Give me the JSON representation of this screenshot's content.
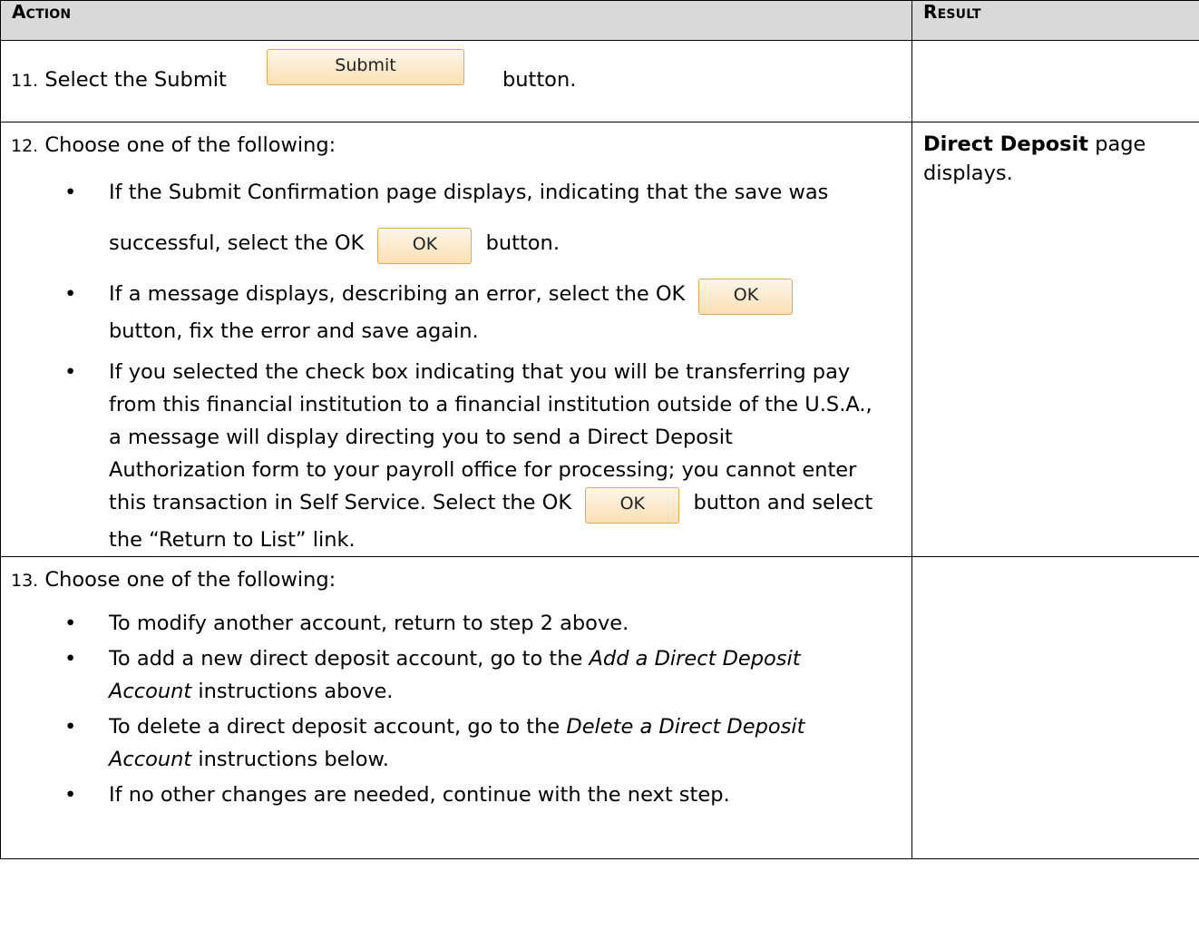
{
  "header": {
    "action": "Action",
    "result": "Result"
  },
  "step11": {
    "num": "11.",
    "text_before": "Select the Submit",
    "button": "Submit",
    "text_after": "button."
  },
  "step12": {
    "num": "12.",
    "intro": "Choose one of the following:",
    "bullet1_a": "If the Submit Confirmation page displays, indicating that the save was successful, select the OK",
    "bullet1_btn": "OK",
    "bullet1_b": "button.",
    "bullet2_a": "If a message displays, describing an error, select the OK",
    "bullet2_btn": "OK",
    "bullet2_b": "button, fix the error and save again.",
    "bullet3_a": "If you selected the check box indicating that you will be transferring pay from this financial institution to a financial institution outside of the U.S.A., a message will display directing you to send a Direct Deposit Authorization form to your payroll office for processing; you cannot enter this transaction in Self Service. Select the OK",
    "bullet3_btn": "OK",
    "bullet3_b": "button and select the “Return to List” link.",
    "result_bold": "Direct Deposit",
    "result_rest": "page displays."
  },
  "step13": {
    "num": "13.",
    "intro": "Choose one of the following:",
    "bullet1": "To modify another account, return to step 2 above.",
    "bullet2_a": "To add a new direct deposit account, go to the",
    "bullet2_em": "Add a Direct Deposit Account",
    "bullet2_b": "instructions above.",
    "bullet3_a": "To delete a direct deposit account, go to the",
    "bullet3_em": "Delete a Direct Deposit Account",
    "bullet3_b": "instructions below.",
    "bullet4": "If no other changes are needed, continue with the next step."
  }
}
